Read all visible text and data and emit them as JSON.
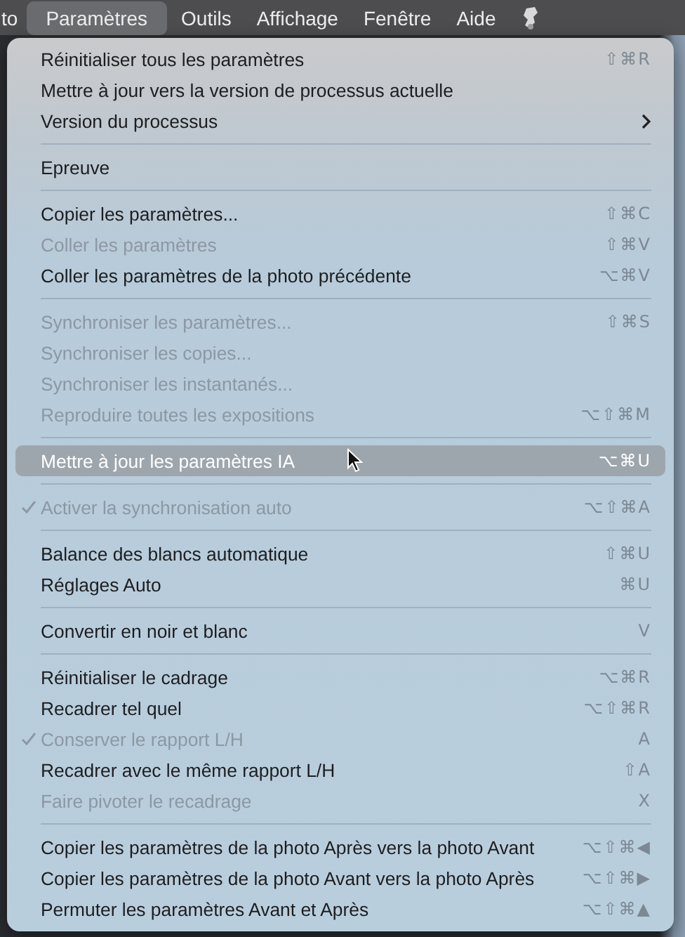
{
  "menubar": [
    {
      "label": "to",
      "selected": false
    },
    {
      "label": "Paramètres",
      "selected": true
    },
    {
      "label": "Outils",
      "selected": false
    },
    {
      "label": "Affichage",
      "selected": false
    },
    {
      "label": "Fenêtre",
      "selected": false
    },
    {
      "label": "Aide",
      "selected": false
    }
  ],
  "menu": [
    {
      "kind": "item",
      "label": "Réinitialiser tous les paramètres",
      "shortcut": "⇧⌘R",
      "disabled": false,
      "checked": false,
      "selected": false
    },
    {
      "kind": "item",
      "label": "Mettre à jour vers la version de processus actuelle",
      "disabled": false,
      "checked": false,
      "selected": false
    },
    {
      "kind": "item",
      "label": "Version du processus",
      "submenu": true,
      "disabled": false,
      "checked": false,
      "selected": false
    },
    {
      "kind": "separator"
    },
    {
      "kind": "item",
      "label": "Epreuve",
      "disabled": false,
      "checked": false,
      "selected": false
    },
    {
      "kind": "separator"
    },
    {
      "kind": "item",
      "label": "Copier les paramètres...",
      "shortcut": "⇧⌘C",
      "disabled": false,
      "checked": false,
      "selected": false
    },
    {
      "kind": "item",
      "label": "Coller les paramètres",
      "shortcut": "⇧⌘V",
      "disabled": true,
      "checked": false,
      "selected": false
    },
    {
      "kind": "item",
      "label": "Coller les paramètres de la photo précédente",
      "shortcut": "⌥⌘V",
      "disabled": false,
      "checked": false,
      "selected": false
    },
    {
      "kind": "separator"
    },
    {
      "kind": "item",
      "label": "Synchroniser les paramètres...",
      "shortcut": "⇧⌘S",
      "disabled": true,
      "checked": false,
      "selected": false
    },
    {
      "kind": "item",
      "label": "Synchroniser les copies...",
      "disabled": true,
      "checked": false,
      "selected": false
    },
    {
      "kind": "item",
      "label": "Synchroniser les instantanés...",
      "disabled": true,
      "checked": false,
      "selected": false
    },
    {
      "kind": "item",
      "label": "Reproduire toutes les expositions",
      "shortcut": "⌥⇧⌘M",
      "disabled": true,
      "checked": false,
      "selected": false
    },
    {
      "kind": "separator"
    },
    {
      "kind": "item",
      "label": "Mettre à jour les paramètres IA",
      "shortcut": "⌥⌘U",
      "disabled": false,
      "checked": false,
      "selected": true
    },
    {
      "kind": "separator"
    },
    {
      "kind": "item",
      "label": "Activer la synchronisation auto",
      "shortcut": "⌥⇧⌘A",
      "disabled": true,
      "checked": true,
      "selected": false
    },
    {
      "kind": "separator"
    },
    {
      "kind": "item",
      "label": "Balance des blancs automatique",
      "shortcut": "⇧⌘U",
      "disabled": false,
      "checked": false,
      "selected": false
    },
    {
      "kind": "item",
      "label": "Réglages Auto",
      "shortcut": "⌘U",
      "disabled": false,
      "checked": false,
      "selected": false
    },
    {
      "kind": "separator"
    },
    {
      "kind": "item",
      "label": "Convertir en noir et blanc",
      "shortcut": "V",
      "disabled": false,
      "checked": false,
      "selected": false
    },
    {
      "kind": "separator"
    },
    {
      "kind": "item",
      "label": "Réinitialiser le cadrage",
      "shortcut": "⌥⌘R",
      "disabled": false,
      "checked": false,
      "selected": false
    },
    {
      "kind": "item",
      "label": "Recadrer tel quel",
      "shortcut": "⌥⇧⌘R",
      "disabled": false,
      "checked": false,
      "selected": false
    },
    {
      "kind": "item",
      "label": "Conserver le rapport L/H",
      "shortcut": "A",
      "disabled": true,
      "checked": true,
      "selected": false
    },
    {
      "kind": "item",
      "label": "Recadrer avec le même rapport L/H",
      "shortcut": "⇧A",
      "disabled": false,
      "checked": false,
      "selected": false
    },
    {
      "kind": "item",
      "label": "Faire pivoter le recadrage",
      "shortcut": "X",
      "disabled": true,
      "checked": false,
      "selected": false
    },
    {
      "kind": "separator"
    },
    {
      "kind": "item",
      "label": "Copier les paramètres de la photo Après vers la photo Avant",
      "shortcut": "⌥⇧⌘◀",
      "disabled": false,
      "checked": false,
      "selected": false
    },
    {
      "kind": "item",
      "label": "Copier les paramètres de la photo Avant vers la photo Après",
      "shortcut": "⌥⇧⌘▶",
      "disabled": false,
      "checked": false,
      "selected": false
    },
    {
      "kind": "item",
      "label": "Permuter les paramètres Avant et Après",
      "shortcut": "⌥⇧⌘▲",
      "disabled": false,
      "checked": false,
      "selected": false
    }
  ]
}
